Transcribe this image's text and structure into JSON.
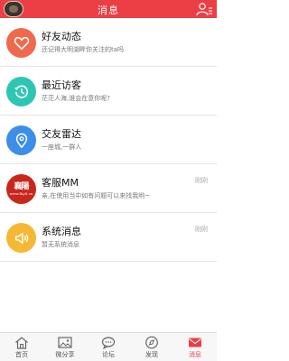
{
  "header": {
    "title": "消息"
  },
  "colors": {
    "accent": "#ec3f45",
    "friend": "#f0694d",
    "visitor": "#2fc5b3",
    "radar": "#3c8ee8",
    "system": "#f6b732"
  },
  "items": [
    {
      "icon": "heart-icon",
      "name": "好友动态",
      "desc": "还记得大明湖畔你关注的ta吗",
      "time": ""
    },
    {
      "icon": "clock-icon",
      "name": "最近访客",
      "desc": "茫茫人海,谁会在意你呢?",
      "time": ""
    },
    {
      "icon": "location-pin-icon",
      "name": "交友雷达",
      "desc": "一座城,一群人",
      "time": ""
    },
    {
      "icon": "service-logo-icon",
      "name": "客服MM",
      "desc": "亲,在使用当中如有问题可以来找我哟~",
      "time": "刚刚",
      "logo_text": "襄陽",
      "logo_sub": "www.lhy8.cn"
    },
    {
      "icon": "speaker-icon",
      "name": "系统消息",
      "desc": "暂无系统消息",
      "time": "刚刚"
    }
  ],
  "tabs": [
    {
      "label": "首页",
      "icon": "home-icon"
    },
    {
      "label": "微分享",
      "icon": "image-icon"
    },
    {
      "label": "论坛",
      "icon": "chat-bubble-icon"
    },
    {
      "label": "发现",
      "icon": "compass-icon"
    },
    {
      "label": "消息",
      "icon": "mail-icon",
      "active": true
    }
  ]
}
